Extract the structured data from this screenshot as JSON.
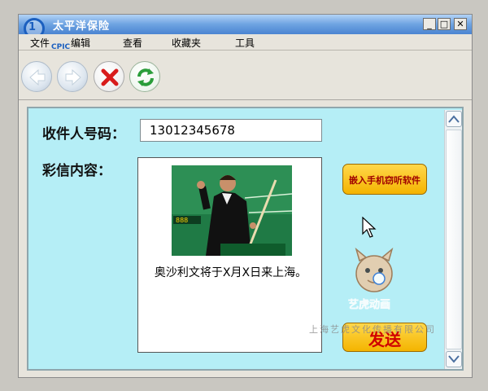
{
  "window": {
    "title": "太平洋保险",
    "logo_text": "CPIC",
    "logo_mark": "1",
    "controls": {
      "minimize": "_",
      "maximize": "□",
      "close": "✕"
    }
  },
  "menu": [
    {
      "label": "文件"
    },
    {
      "label": "编辑"
    },
    {
      "label": "查看"
    },
    {
      "label": "收藏夹"
    },
    {
      "label": "工具"
    }
  ],
  "toolbar": {
    "icons": [
      "back-icon",
      "forward-icon",
      "stop-icon",
      "refresh-icon"
    ]
  },
  "form": {
    "recipient_label": "收件人号码：",
    "recipient_value": "13012345678",
    "content_label": "彩信内容：",
    "mms_caption": "奥沙利文将于X月X日来上海。",
    "photo_board_text": "888",
    "eavesdrop_button": "嵌入手机窃听软件",
    "send_button": "发送"
  },
  "watermark": {
    "logo_text": "艺虎动画",
    "company_text": "上海艺虎文化传播有限公司"
  },
  "colors": {
    "content_bg": "#b5eef6",
    "button_yellow": "#f4b400",
    "button_text_red": "#d00000",
    "titlebar_blue": "#4a84d1"
  }
}
